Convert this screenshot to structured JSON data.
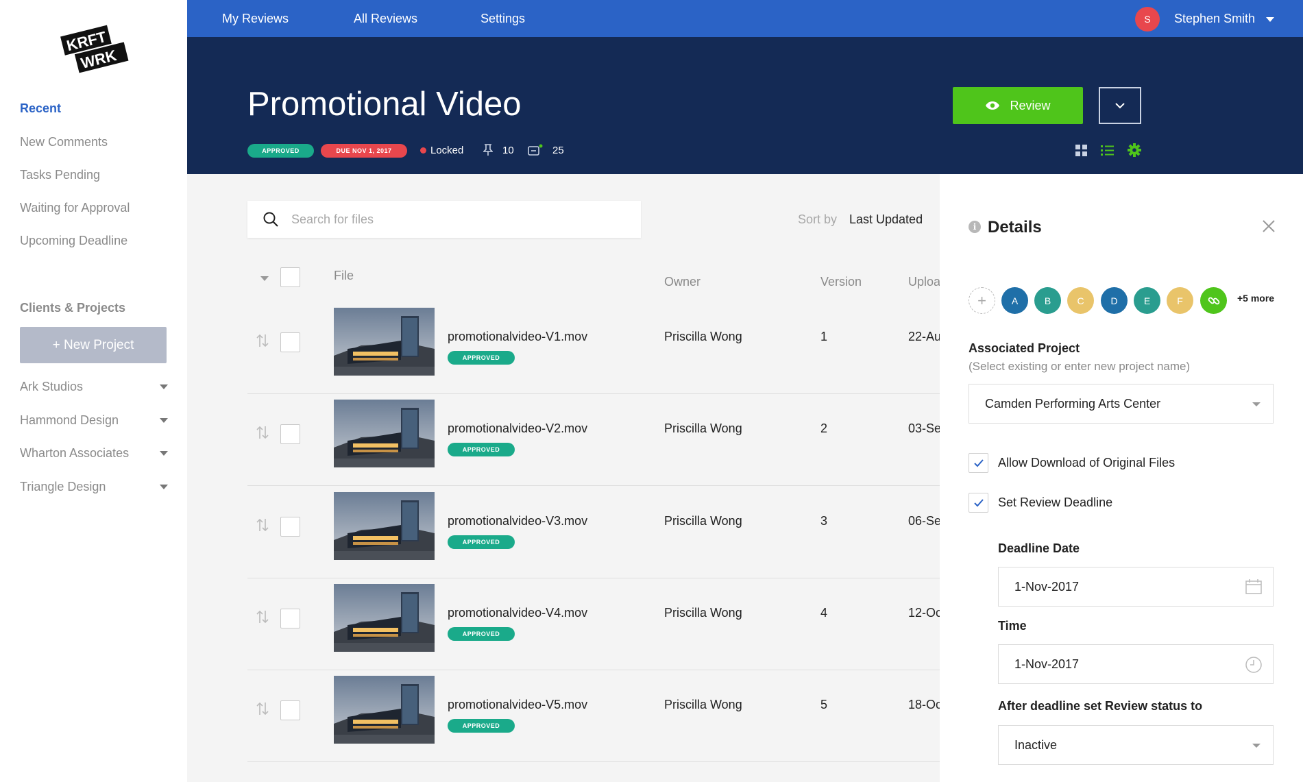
{
  "app": {
    "logo_line1": "KRFT",
    "logo_line2": "WRK"
  },
  "sidebar": {
    "links": [
      {
        "label": "Recent",
        "active": true
      },
      {
        "label": "New Comments"
      },
      {
        "label": "Tasks Pending"
      },
      {
        "label": "Waiting for Approval"
      },
      {
        "label": "Upcoming Deadline"
      }
    ],
    "clients_heading": "Clients & Projects",
    "new_project_label": "+  New Project",
    "clients": [
      "Ark Studios",
      "Hammond Design",
      "Wharton Associates",
      "Triangle Design"
    ]
  },
  "topnav": {
    "links": [
      "My Reviews",
      "All Reviews",
      "Settings"
    ],
    "user_initial": "S",
    "user_name": "Stephen Smith"
  },
  "header": {
    "title": "Promotional Video",
    "status_badge": "APPROVED",
    "due_badge": "DUE NOV 1, 2017",
    "locked_label": "Locked",
    "pins_count": "10",
    "comments_count": "25",
    "review_button": "Review"
  },
  "list": {
    "search_placeholder": "Search for files",
    "sort_label": "Sort by",
    "sort_value": "Last Updated",
    "columns": {
      "file": "File",
      "owner": "Owner",
      "version": "Version",
      "uploaded": "Uploa"
    },
    "rows": [
      {
        "name": "promotionalvideo-V1.mov",
        "badge": "APPROVED",
        "owner": "Priscilla Wong",
        "version": "1",
        "uploaded": "22-Au"
      },
      {
        "name": "promotionalvideo-V2.mov",
        "badge": "APPROVED",
        "owner": "Priscilla Wong",
        "version": "2",
        "uploaded": "03-Se"
      },
      {
        "name": "promotionalvideo-V3.mov",
        "badge": "APPROVED",
        "owner": "Priscilla Wong",
        "version": "3",
        "uploaded": "06-Se"
      },
      {
        "name": "promotionalvideo-V4.mov",
        "badge": "APPROVED",
        "owner": "Priscilla Wong",
        "version": "4",
        "uploaded": "12-Oc"
      },
      {
        "name": "promotionalvideo-V5.mov",
        "badge": "APPROVED",
        "owner": "Priscilla Wong",
        "version": "5",
        "uploaded": "18-Oc"
      }
    ]
  },
  "details": {
    "title": "Details",
    "collaborators": [
      {
        "initial": "A",
        "color": "#1f6fa8"
      },
      {
        "initial": "B",
        "color": "#2a9d8f"
      },
      {
        "initial": "C",
        "color": "#e9c46a"
      },
      {
        "initial": "D",
        "color": "#1f6fa8"
      },
      {
        "initial": "E",
        "color": "#2a9d8f"
      },
      {
        "initial": "F",
        "color": "#e9c46a"
      }
    ],
    "more_label": "+5 more",
    "associated_project_label": "Associated Project",
    "associated_project_hint": "(Select existing or enter new project name)",
    "associated_project_value": "Camden Performing Arts Center",
    "allow_download_label": "Allow Download of Original Files",
    "set_deadline_label": "Set Review Deadline",
    "deadline_date_label": "Deadline Date",
    "deadline_date_value": "1-Nov-2017",
    "time_label": "Time",
    "time_value": "1-Nov-2017",
    "after_deadline_label": "After deadline set Review status to",
    "after_deadline_value": "Inactive"
  },
  "colors": {
    "primary": "#2b63c6",
    "header_bg": "#142a55",
    "approved": "#1aaa8a",
    "due": "#e8474d",
    "review": "#4fc51b"
  }
}
